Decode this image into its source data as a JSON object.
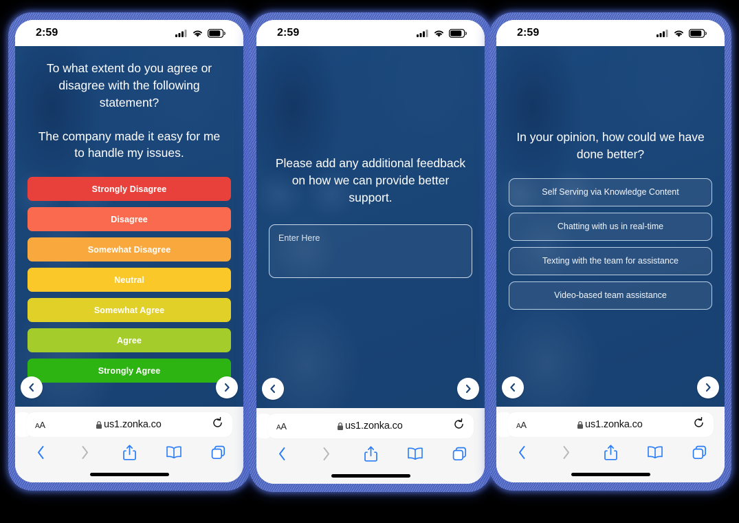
{
  "background_color": "#000000",
  "device_frame_color": "#4d68c2",
  "survey_bg_color": "#1d4577",
  "phones": [
    {
      "id": "phone-1",
      "status": {
        "time": "2:59",
        "cellular_icon": "signal-bars-icon",
        "wifi_icon": "wifi-icon",
        "battery_icon": "battery-icon"
      },
      "survey": {
        "type": "likert-scale",
        "paragraphs": [
          "To what extent do you agree or disagree with the following statement?",
          "The company made it easy for me to handle my issues."
        ],
        "options": [
          {
            "label": "Strongly Disagree",
            "color": "#e8403a"
          },
          {
            "label": "Disagree",
            "color": "#f96a4f"
          },
          {
            "label": "Somewhat Disagree",
            "color": "#f8a83c"
          },
          {
            "label": "Neutral",
            "color": "#fbc82a"
          },
          {
            "label": "Somewhat Agree",
            "color": "#e0d028"
          },
          {
            "label": "Agree",
            "color": "#a4cd2b"
          },
          {
            "label": "Strongly Agree",
            "color": "#2db312"
          }
        ],
        "prev_icon": "chevron-left-icon",
        "next_icon": "chevron-right-icon"
      },
      "browser": {
        "text_size_label": "AA",
        "lock_icon": "lock-icon",
        "url": "us1.zonka.co",
        "reload_icon": "reload-icon",
        "back_icon": "chevron-left-icon",
        "forward_icon": "chevron-right-icon",
        "share_icon": "share-icon",
        "bookmarks_icon": "book-icon",
        "tabs_icon": "tabs-icon"
      }
    },
    {
      "id": "phone-2",
      "status": {
        "time": "2:59",
        "cellular_icon": "signal-bars-icon",
        "wifi_icon": "wifi-icon",
        "battery_icon": "battery-icon"
      },
      "survey": {
        "type": "open-text",
        "paragraphs": [
          "Please add any additional feedback on how we can provide better support."
        ],
        "input": {
          "value": "",
          "placeholder": "Enter Here"
        },
        "prev_icon": "chevron-left-icon",
        "next_icon": "chevron-right-icon"
      },
      "browser": {
        "text_size_label": "AA",
        "lock_icon": "lock-icon",
        "url": "us1.zonka.co",
        "reload_icon": "reload-icon",
        "back_icon": "chevron-left-icon",
        "forward_icon": "chevron-right-icon",
        "share_icon": "share-icon",
        "bookmarks_icon": "book-icon",
        "tabs_icon": "tabs-icon"
      }
    },
    {
      "id": "phone-3",
      "status": {
        "time": "2:59",
        "cellular_icon": "signal-bars-icon",
        "wifi_icon": "wifi-icon",
        "battery_icon": "battery-icon"
      },
      "survey": {
        "type": "multiple-choice",
        "paragraphs": [
          "In your opinion, how could we have done better?"
        ],
        "options": [
          {
            "label": "Self Serving via Knowledge Content"
          },
          {
            "label": "Chatting with us in real-time"
          },
          {
            "label": "Texting with the team for assistance"
          },
          {
            "label": "Video-based team assistance"
          }
        ],
        "prev_icon": "chevron-left-icon",
        "next_icon": "chevron-right-icon"
      },
      "browser": {
        "text_size_label": "AA",
        "lock_icon": "lock-icon",
        "url": "us1.zonka.co",
        "reload_icon": "reload-icon",
        "back_icon": "chevron-left-icon",
        "forward_icon": "chevron-right-icon",
        "share_icon": "share-icon",
        "bookmarks_icon": "book-icon",
        "tabs_icon": "tabs-icon"
      }
    }
  ]
}
